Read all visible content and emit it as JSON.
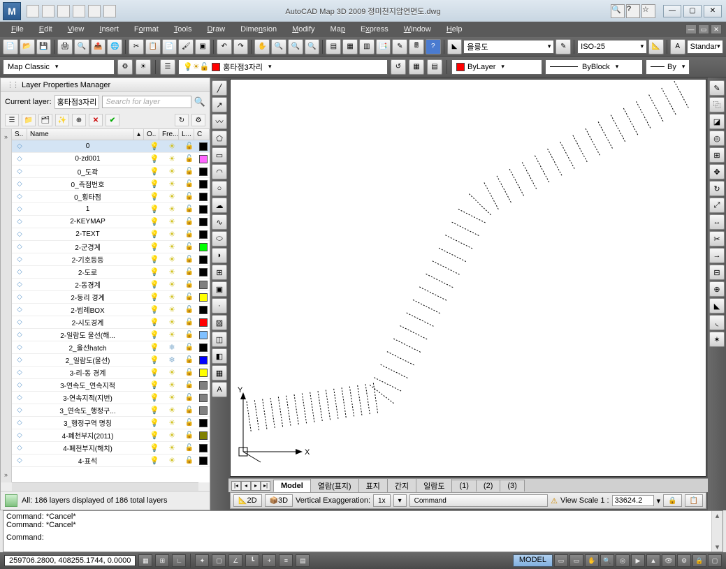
{
  "titlebar": {
    "app_letter": "M",
    "title": "AutoCAD Map 3D 2009 정미천지압연면도.dwg"
  },
  "menu": {
    "file": "File",
    "edit": "Edit",
    "view": "View",
    "insert": "Insert",
    "format": "Format",
    "tools": "Tools",
    "draw": "Draw",
    "dimension": "Dimension",
    "modify": "Modify",
    "map": "Map",
    "express": "Express",
    "window": "Window",
    "help": "Help"
  },
  "toolbar": {
    "layer_dd": "을릉도",
    "dim_dd": "ISO-25",
    "std_dd": "Standar"
  },
  "workspace": {
    "ws_dd": "Map Classic",
    "layer_tool": "홍타점3자리",
    "bylayer": "ByLayer",
    "byblock": "ByBlock",
    "by": "By"
  },
  "panel": {
    "title": "Layer Properties Manager",
    "current_lbl": "Current  layer:",
    "current_val": "홍타점3자리",
    "search_ph": "Search for layer",
    "status": "All: 186 layers displayed of 186 total layers"
  },
  "gridhead": {
    "status": "S..",
    "name": "Name",
    "on": "O..",
    "freeze": "Fre...",
    "lock": "L...",
    "color": "C"
  },
  "layers": [
    {
      "name": "0",
      "on": true,
      "frozen": false,
      "color": "#000000"
    },
    {
      "name": "0-zd001",
      "on": true,
      "frozen": false,
      "color": "#ff66ff"
    },
    {
      "name": "0_도곽",
      "on": true,
      "frozen": false,
      "color": "#000000"
    },
    {
      "name": "0_측점번호",
      "on": true,
      "frozen": false,
      "color": "#000000"
    },
    {
      "name": "0_횡타점",
      "on": true,
      "frozen": false,
      "color": "#000000"
    },
    {
      "name": "1",
      "on": true,
      "frozen": false,
      "color": "#000000"
    },
    {
      "name": "2-KEYMAP",
      "on": true,
      "frozen": false,
      "color": "#000000"
    },
    {
      "name": "2-TEXT",
      "on": true,
      "frozen": false,
      "color": "#000000"
    },
    {
      "name": "2-군경계",
      "on": true,
      "frozen": false,
      "color": "#00ff00"
    },
    {
      "name": "2-기호등등",
      "on": true,
      "frozen": false,
      "color": "#000000"
    },
    {
      "name": "2-도로",
      "on": true,
      "frozen": false,
      "color": "#000000"
    },
    {
      "name": "2-동경계",
      "on": true,
      "frozen": false,
      "color": "#808080"
    },
    {
      "name": "2-동리 경계",
      "on": true,
      "frozen": false,
      "color": "#ffff00"
    },
    {
      "name": "2-범례BOX",
      "on": true,
      "frozen": false,
      "color": "#000000"
    },
    {
      "name": "2-시도경계",
      "on": true,
      "frozen": false,
      "color": "#ff0000"
    },
    {
      "name": "2-일람도 울선(해...",
      "on": true,
      "frozen": false,
      "color": "#80c0ff"
    },
    {
      "name": "2_울선hatch",
      "on": true,
      "frozen": true,
      "color": "#000000"
    },
    {
      "name": "2_일람도(울선)",
      "on": true,
      "frozen": true,
      "color": "#0000ff"
    },
    {
      "name": "3-리-동 경계",
      "on": true,
      "frozen": false,
      "color": "#ffff00"
    },
    {
      "name": "3-연속도_연속지적",
      "on": true,
      "frozen": false,
      "color": "#808080"
    },
    {
      "name": "3-연속지적(지번)",
      "on": true,
      "frozen": false,
      "color": "#808080"
    },
    {
      "name": "3_연속도_행정구...",
      "on": true,
      "frozen": false,
      "color": "#808080"
    },
    {
      "name": "3_행정구역 명칭",
      "on": true,
      "frozen": false,
      "color": "#000000"
    },
    {
      "name": "4-폐천부지(2011)",
      "on": true,
      "frozen": false,
      "color": "#808000"
    },
    {
      "name": "4-폐천부지(해치)",
      "on": true,
      "frozen": false,
      "color": "#000000"
    },
    {
      "name": "4-표석",
      "on": true,
      "frozen": false,
      "color": "#000000"
    }
  ],
  "tabs": {
    "model": "Model",
    "t1": "열람(표지)",
    "t2": "표지",
    "t3": "간지",
    "t4": "일람도",
    "t5": "(1)",
    "t6": "(2)",
    "t7": "(3)"
  },
  "viewbar": {
    "b2d": "2D",
    "b3d": "3D",
    "ve_label": "Vertical Exaggeration:",
    "ve_val": "1x",
    "cmd": "Command",
    "vs_label": "View Scale   1 :",
    "vs_val": "33624.2"
  },
  "cmd": {
    "l1": "Command: *Cancel*",
    "l2": "Command: *Cancel*",
    "l3": "Command:"
  },
  "statusbar": {
    "coords": "259706.2800, 408255.1744, 0.0000",
    "model": "MODEL"
  }
}
